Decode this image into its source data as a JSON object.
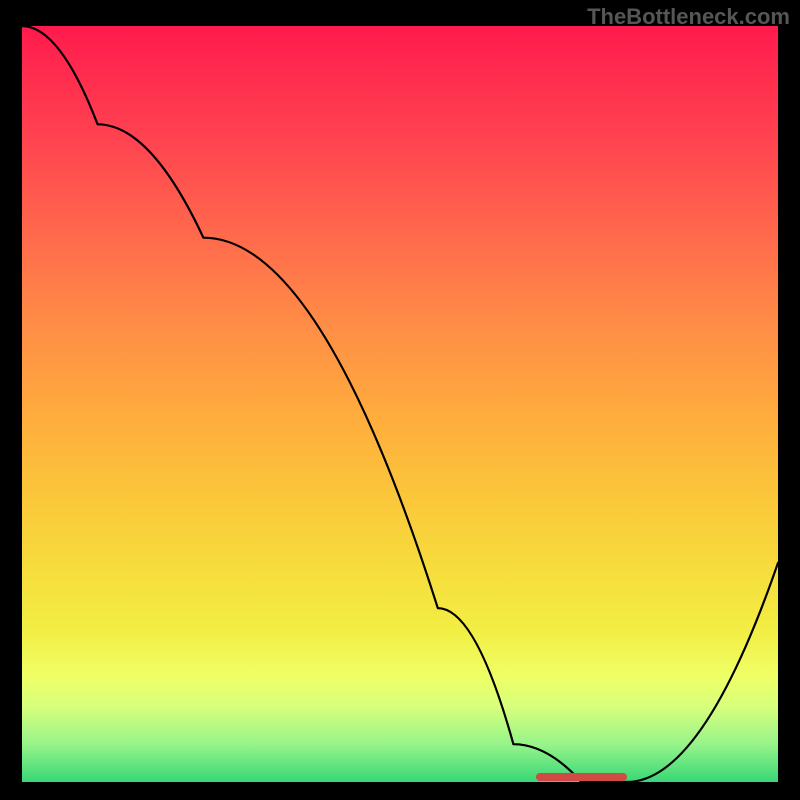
{
  "watermark": "TheBottleneck.com",
  "chart_data": {
    "type": "line",
    "title": "",
    "xlabel": "",
    "ylabel": "",
    "xlim": [
      0,
      100
    ],
    "ylim": [
      0,
      100
    ],
    "grid": false,
    "legend": false,
    "series": [
      {
        "name": "bottleneck-curve",
        "x": [
          0,
          10,
          24,
          55,
          65,
          74,
          80,
          100
        ],
        "values": [
          100,
          87,
          72,
          23,
          5,
          0,
          0,
          29
        ]
      }
    ],
    "minimum_band": {
      "x_start": 68,
      "x_end": 80,
      "y": 0.7
    },
    "background_gradient": {
      "direction": "vertical",
      "stops": [
        {
          "pos": 0,
          "color": "#ff1a4d"
        },
        {
          "pos": 40,
          "color": "#ff8e46"
        },
        {
          "pos": 72,
          "color": "#f6dd3c"
        },
        {
          "pos": 90,
          "color": "#d8ff7c"
        },
        {
          "pos": 100,
          "color": "#38d776"
        }
      ]
    }
  }
}
